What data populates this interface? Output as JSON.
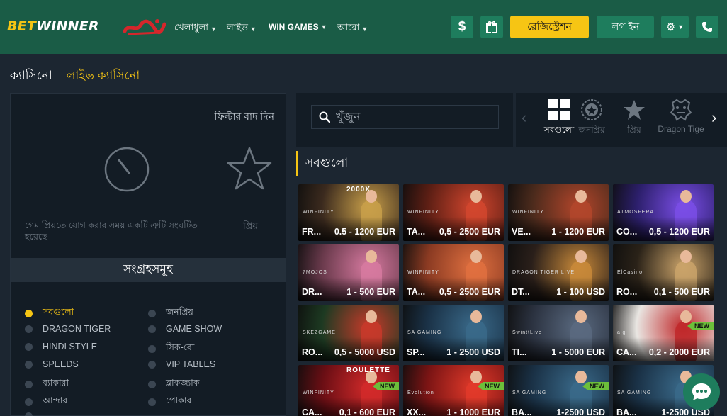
{
  "header": {
    "logo_bet": "BET",
    "logo_winner": "WINNER",
    "nav": [
      {
        "label": "খেলাধুলা"
      },
      {
        "label": "লাইভ"
      },
      {
        "label": "WIN GAMES"
      },
      {
        "label": "আরো"
      }
    ],
    "register_label": "রেজিস্ট্রেশন",
    "login_label": "লগ ইন"
  },
  "tabs": {
    "casino": "ক্যাসিনো",
    "live_casino": "লাইভ ক্যাসিনো"
  },
  "favorites": {
    "reset_filter": "ফিল্টার বাদ দিন",
    "note": "গেম প্রিয়তে যোগ করার সময় একটি ত্রুটি সংঘটিত হয়েছে",
    "label": "প্রিয়"
  },
  "collections": {
    "title": "সংগ্রহসমূহ",
    "items": [
      {
        "label": "সবগুলো",
        "active": true
      },
      {
        "label": "জনপ্রিয়"
      },
      {
        "label": "DRAGON TIGER"
      },
      {
        "label": "GAME SHOW"
      },
      {
        "label": "HINDI STYLE"
      },
      {
        "label": "সিক-বো"
      },
      {
        "label": "SPEEDS"
      },
      {
        "label": "VIP TABLES"
      },
      {
        "label": "ব্যাকারা"
      },
      {
        "label": "ব্লাকজ্যাক"
      },
      {
        "label": "আন্দার"
      },
      {
        "label": "পোকার"
      }
    ]
  },
  "search": {
    "placeholder": "খুঁজুন"
  },
  "categories": [
    {
      "label": "সবগুলো",
      "icon": "grid-icon",
      "active": true
    },
    {
      "label": "জনপ্রিয়",
      "icon": "badge-icon"
    },
    {
      "label": "প্রিয়",
      "icon": "star-icon"
    },
    {
      "label": "Dragon Tige",
      "icon": "dragon-icon"
    }
  ],
  "section_title": "সবগুলো",
  "games": [
    {
      "name": "FR...",
      "limit": "0.5 - 1200 EUR",
      "bg": "#3b2a1e",
      "accent": "#c9a04a",
      "badge": "",
      "banner": "2000X",
      "provider": "WINFINITY"
    },
    {
      "name": "TA...",
      "limit": "0,5 - 2500 EUR",
      "bg": "#5b1e14",
      "accent": "#d2462e",
      "badge": "",
      "banner": "",
      "provider": "WINFINITY"
    },
    {
      "name": "VE...",
      "limit": "1 - 1200 EUR",
      "bg": "#4a2a1c",
      "accent": "#b3462b",
      "badge": "",
      "banner": "",
      "provider": "WINFINITY"
    },
    {
      "name": "CO...",
      "limit": "0,5 - 1200 EUR",
      "bg": "#2c1f6b",
      "accent": "#7a4ee6",
      "badge": "",
      "banner": "",
      "provider": "ATMOSFERA"
    },
    {
      "name": "DR...",
      "limit": "1 - 500 EUR",
      "bg": "#6a3a4c",
      "accent": "#d77aa0",
      "badge": "",
      "banner": "",
      "provider": "7MOJOS"
    },
    {
      "name": "TA...",
      "limit": "0,5 - 2500 EUR",
      "bg": "#8a3a22",
      "accent": "#e07040",
      "badge": "",
      "banner": "",
      "provider": "WINFINITY"
    },
    {
      "name": "DT...",
      "limit": "1 - 100 USD",
      "bg": "#2a1f1a",
      "accent": "#c98a3a",
      "badge": "",
      "banner": "",
      "provider": "DRAGON TIGER LIVE"
    },
    {
      "name": "RO...",
      "limit": "0,1 - 500 EUR",
      "bg": "#2a2218",
      "accent": "#caa36a",
      "badge": "",
      "banner": "",
      "provider": "ElCasino"
    },
    {
      "name": "RO...",
      "limit": "0,5 - 5000 USD",
      "bg": "#1d3a22",
      "accent": "#c83a2a",
      "badge": "",
      "banner": "",
      "provider": "SKEZGAME"
    },
    {
      "name": "SP...",
      "limit": "1 - 2500 USD",
      "bg": "#1a3146",
      "accent": "#3a6a8a",
      "badge": "",
      "banner": "",
      "provider": "SA GAMING"
    },
    {
      "name": "TI...",
      "limit": "1 - 5000 EUR",
      "bg": "#2b3240",
      "accent": "#5a6a80",
      "badge": "",
      "banner": "",
      "provider": "SwinttLive"
    },
    {
      "name": "CA...",
      "limit": "0,2 - 2000 EUR",
      "bg": "#e9e6e2",
      "accent": "#c0282a",
      "badge": "NEW",
      "banner": "",
      "provider": "alg"
    },
    {
      "name": "CA...",
      "limit": "0,1 - 600 EUR",
      "bg": "#6a0e14",
      "accent": "#d22a2a",
      "badge": "NEW",
      "banner": "ROULETTE",
      "provider": "WINFINITY"
    },
    {
      "name": "XX...",
      "limit": "1 - 1000 EUR",
      "bg": "#7a1414",
      "accent": "#e23a2a",
      "badge": "NEW",
      "banner": "",
      "provider": "Evolution"
    },
    {
      "name": "BA...",
      "limit": "1-2500 USD",
      "bg": "#1a3146",
      "accent": "#3a6a8a",
      "badge": "NEW",
      "banner": "",
      "provider": "SA GAMING"
    },
    {
      "name": "BA...",
      "limit": "1-2500 USD",
      "bg": "#1a3146",
      "accent": "#3a6a8a",
      "badge": "",
      "banner": "",
      "provider": "SA GAMING"
    }
  ],
  "colors": {
    "header": "#1a5c46",
    "accent_yellow": "#f6c514",
    "panel": "#131c25",
    "page": "#1c2631"
  }
}
